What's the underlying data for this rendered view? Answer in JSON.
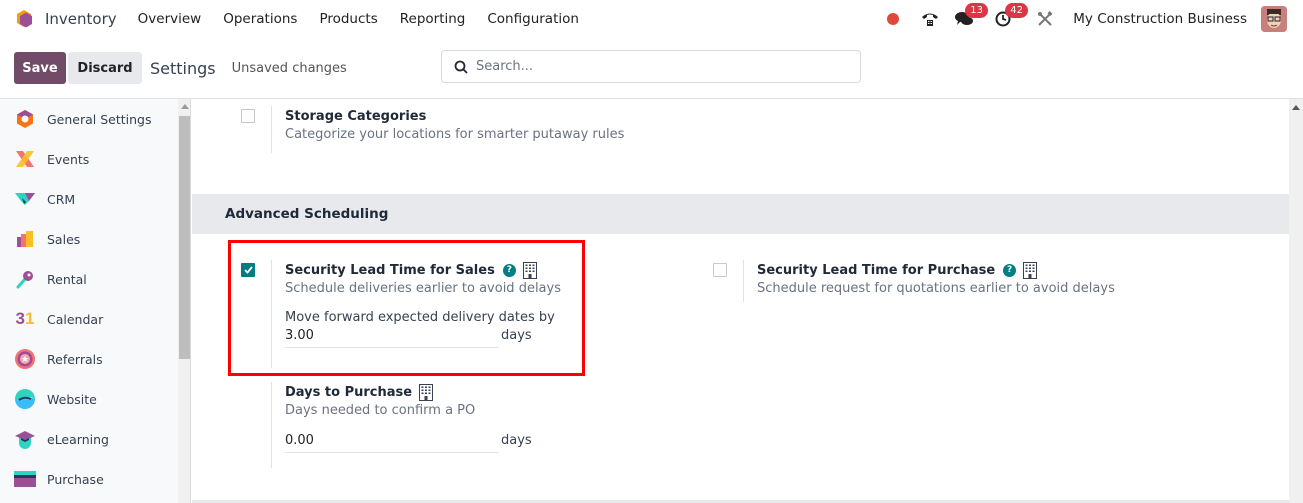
{
  "navbar": {
    "app_name": "Inventory",
    "menu": [
      "Overview",
      "Operations",
      "Products",
      "Reporting",
      "Configuration"
    ],
    "systray": {
      "messages_count": "13",
      "activities_count": "42",
      "company": "My Construction Business"
    }
  },
  "controlbar": {
    "save_label": "Save",
    "discard_label": "Discard",
    "title": "Settings",
    "status": "Unsaved changes",
    "search_placeholder": "Search..."
  },
  "sidebar": {
    "items": [
      {
        "label": "General Settings",
        "icon": "general-settings-icon"
      },
      {
        "label": "Events",
        "icon": "events-icon"
      },
      {
        "label": "CRM",
        "icon": "crm-icon"
      },
      {
        "label": "Sales",
        "icon": "sales-icon"
      },
      {
        "label": "Rental",
        "icon": "rental-icon"
      },
      {
        "label": "Calendar",
        "icon": "calendar-icon",
        "glyph": "31"
      },
      {
        "label": "Referrals",
        "icon": "referrals-icon"
      },
      {
        "label": "Website",
        "icon": "website-icon"
      },
      {
        "label": "eLearning",
        "icon": "elearning-icon"
      },
      {
        "label": "Purchase",
        "icon": "purchase-icon"
      }
    ]
  },
  "content": {
    "storage_categories": {
      "title": "Storage Categories",
      "description": "Categorize your locations for smarter putaway rules",
      "checked": false
    },
    "section_title": "Advanced Scheduling",
    "lead_time_sales": {
      "title": "Security Lead Time for Sales",
      "description": "Schedule deliveries earlier to avoid delays",
      "checked": true,
      "field_label": "Move forward expected delivery dates by",
      "value": "3.00",
      "unit": "days"
    },
    "lead_time_purchase": {
      "title": "Security Lead Time for Purchase",
      "description": "Schedule request for quotations earlier to avoid delays",
      "checked": false
    },
    "days_to_purchase": {
      "title": "Days to Purchase",
      "description": "Days needed to confirm a PO",
      "value": "0.00",
      "unit": "days"
    }
  },
  "colors": {
    "primary": "#714b67",
    "accent": "#017e84",
    "highlight": "#ff0000",
    "badge": "#dc3545"
  }
}
